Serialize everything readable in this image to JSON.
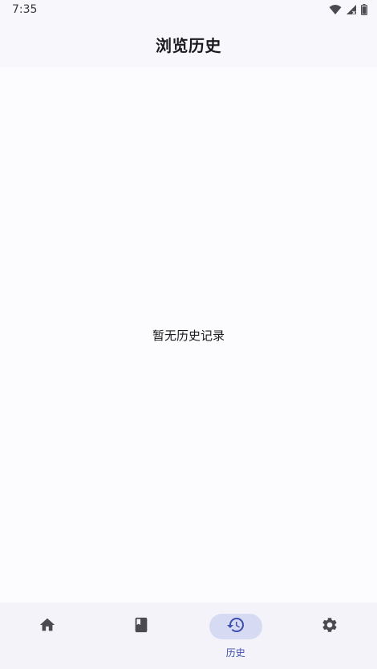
{
  "status_bar": {
    "time": "7:35",
    "icons": [
      "wifi-icon",
      "signal-icon",
      "battery-icon"
    ]
  },
  "header": {
    "title": "浏览历史"
  },
  "main": {
    "empty_message": "暂无历史记录"
  },
  "bottom_nav": {
    "items": [
      {
        "icon": "home-icon",
        "label": "",
        "active": false
      },
      {
        "icon": "book-icon",
        "label": "",
        "active": false
      },
      {
        "icon": "history-icon",
        "label": "历史",
        "active": true
      },
      {
        "icon": "gear-icon",
        "label": "",
        "active": false
      }
    ]
  },
  "colors": {
    "background": "#fcfcff",
    "bar_background": "#f7f7fc",
    "nav_background": "#f3f3f9",
    "active_pill": "#d6daf3",
    "accent": "#3d4eb0",
    "icon": "#4a4a50"
  }
}
